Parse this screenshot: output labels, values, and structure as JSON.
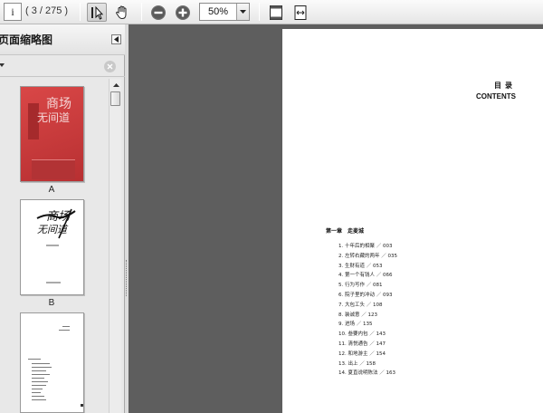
{
  "toolbar": {
    "page_field": "i",
    "page_count": "( 3 / 275 )",
    "zoom": "50%"
  },
  "sidebar": {
    "title": "页面缩略图",
    "thumbnails": [
      {
        "label": "A",
        "cover_title_1": "商场",
        "cover_title_2": "无间道"
      },
      {
        "label": "B",
        "cover_title_1": "商场",
        "cover_title_2": "无间道"
      },
      {
        "label": ""
      }
    ]
  },
  "document": {
    "toc_title_cn": "目录",
    "toc_title_en": "CONTENTS",
    "chapter": "第一章　走麦城",
    "items": [
      "1.  十年后的相聚 ／ 003",
      "2.  左转右藏的两年 ／ 035",
      "3.  生财有道 ／ 053",
      "4.  第一个有钱人 ／ 066",
      "5.  行为写作 ／ 081",
      "6.  院子里的冲动 ／ 093",
      "7.  大包工头 ／ 108",
      "8.  装诚意 ／ 123",
      "9.  进场 ／ 135",
      "10.  叁要内包 ／ 143",
      "11.  清悦通告 ／ 147",
      "12.  和地游主 ／ 154",
      "13.  出上 ／ 158",
      "14.  夏直说明陈法 ／ 163"
    ]
  },
  "colors": {
    "doc_background": "#5e5e5e",
    "cover_red": "#c9393a"
  }
}
